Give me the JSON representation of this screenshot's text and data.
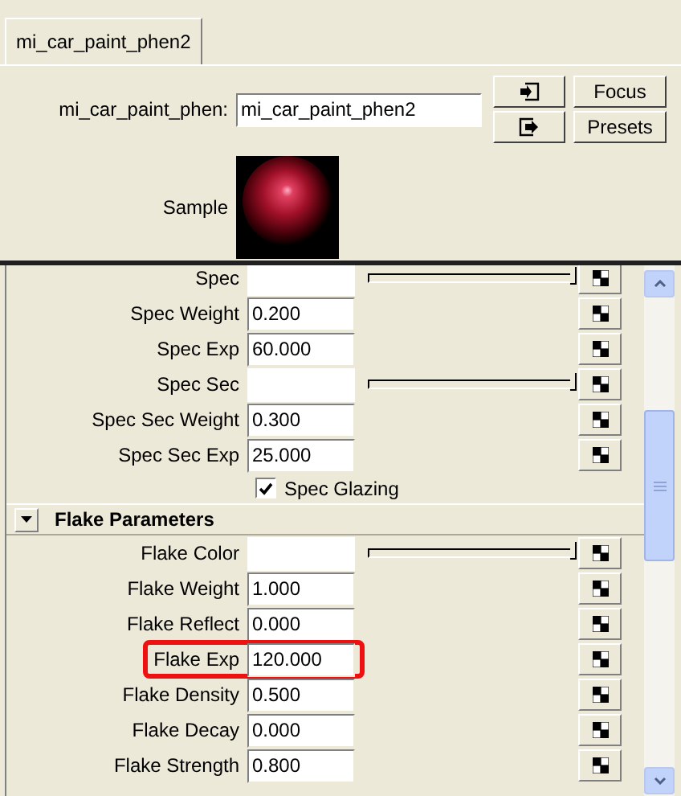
{
  "tabs": [
    {
      "label": "mi_car_paint_phen2",
      "selected": true
    }
  ],
  "node": {
    "label": "mi_car_paint_phen:",
    "value": "mi_car_paint_phen2",
    "buttons": [
      "Focus",
      "Presets"
    ],
    "sample_label": "Sample"
  },
  "attributes": [
    {
      "kind": "color",
      "label": "Spec",
      "level": 1
    },
    {
      "kind": "number",
      "label": "Spec Weight",
      "value": "0.200"
    },
    {
      "kind": "number",
      "label": "Spec Exp",
      "value": "60.000"
    },
    {
      "kind": "color",
      "label": "Spec Sec",
      "level": 1
    },
    {
      "kind": "number",
      "label": "Spec Sec Weight",
      "value": "0.300"
    },
    {
      "kind": "number",
      "label": "Spec Sec Exp",
      "value": "25.000"
    },
    {
      "kind": "checkbox",
      "label": "Spec Glazing",
      "checked": true
    },
    {
      "kind": "section",
      "label": "Flake Parameters",
      "expanded": true
    },
    {
      "kind": "color",
      "label": "Flake Color",
      "level": 1
    },
    {
      "kind": "number",
      "label": "Flake Weight",
      "value": "1.000"
    },
    {
      "kind": "number",
      "label": "Flake Reflect",
      "value": "0.000"
    },
    {
      "kind": "number",
      "label": "Flake Exp",
      "value": "120.000",
      "highlighted": true
    },
    {
      "kind": "number",
      "label": "Flake Density",
      "value": "0.500"
    },
    {
      "kind": "number",
      "label": "Flake Decay",
      "value": "0.000"
    },
    {
      "kind": "number",
      "label": "Flake Strength",
      "value": "0.800"
    }
  ]
}
